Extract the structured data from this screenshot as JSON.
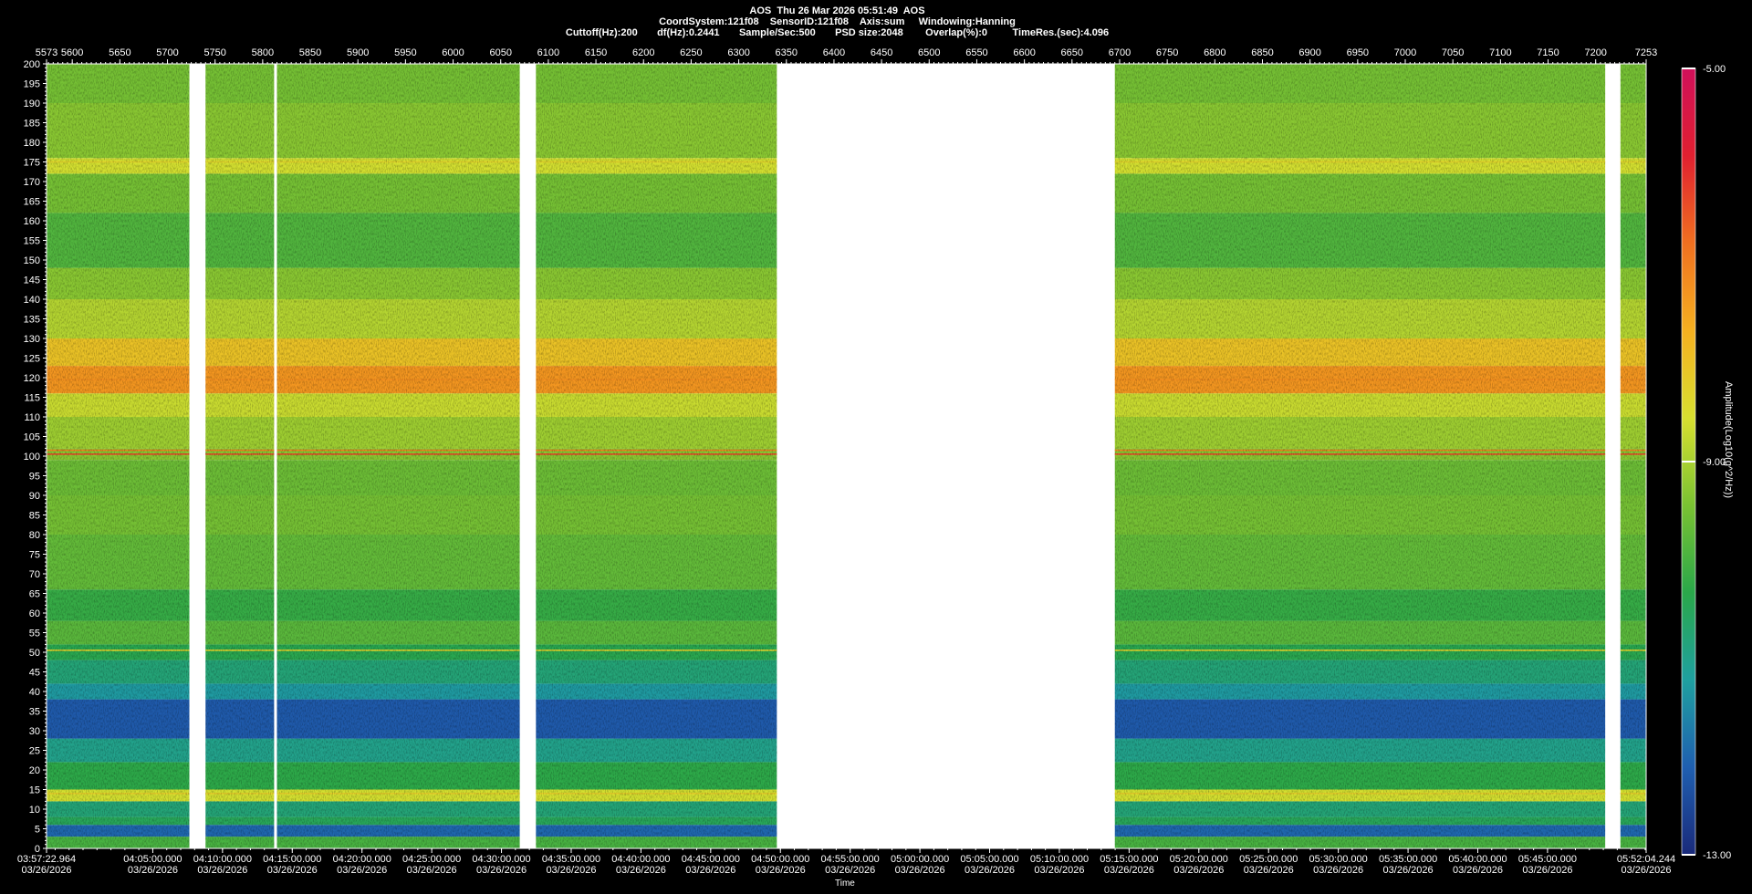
{
  "header": {
    "line1": "AOS  Thu 26 Mar 2026 05:51:49  AOS",
    "line2": "CoordSystem:121f08    SensorID:121f08    Axis:sum     Windowing:Hanning",
    "line3": "Cuttoff(Hz):200       df(Hz):0.2441       Sample/Sec:500       PSD size:2048        Overlap(%):0         TimeRes.(sec):4.096"
  },
  "chart_data": {
    "type": "heatmap",
    "title": "AOS  Thu 26 Mar 2026 05:51:49  AOS",
    "xlabel": "Time",
    "ylabel": "",
    "colorbar_label": "Amplitude(Log10(g^2/Hz))",
    "colorbar_ticks": [
      "-5.00",
      "-9.00",
      "-13.00"
    ],
    "colorbar_range": [
      -13.0,
      -5.0
    ],
    "colormap": [
      "#1a2a7a",
      "#1f5fb0",
      "#1fa0a0",
      "#2aa84a",
      "#7ac232",
      "#d8e030",
      "#f5b020",
      "#f07020",
      "#e02030",
      "#d0105a"
    ],
    "ylim": [
      0,
      200
    ],
    "y_ticks": [
      0,
      5,
      10,
      15,
      20,
      25,
      30,
      35,
      40,
      45,
      50,
      55,
      60,
      65,
      70,
      75,
      80,
      85,
      90,
      95,
      100,
      105,
      110,
      115,
      120,
      125,
      130,
      135,
      140,
      145,
      150,
      155,
      160,
      165,
      170,
      175,
      180,
      185,
      190,
      195,
      200
    ],
    "top_axis_ticks": [
      "5573",
      "5600",
      "5650",
      "5700",
      "5750",
      "5800",
      "5850",
      "5900",
      "5950",
      "6000",
      "6050",
      "6100",
      "6150",
      "6200",
      "6250",
      "6300",
      "6350",
      "6400",
      "6450",
      "6500",
      "6550",
      "6600",
      "6650",
      "6700",
      "6750",
      "6800",
      "6850",
      "6900",
      "6950",
      "7000",
      "7050",
      "7100",
      "7150",
      "7200",
      "7253"
    ],
    "top_axis_range": [
      5573,
      7253
    ],
    "bottom_axis_ticks": [
      {
        "time": "03:57:22.964",
        "date": "03/26/2026"
      },
      {
        "time": "04:05:00.000",
        "date": "03/26/2026"
      },
      {
        "time": "04:10:00.000",
        "date": "03/26/2026"
      },
      {
        "time": "04:15:00.000",
        "date": "03/26/2026"
      },
      {
        "time": "04:20:00.000",
        "date": "03/26/2026"
      },
      {
        "time": "04:25:00.000",
        "date": "03/26/2026"
      },
      {
        "time": "04:30:00.000",
        "date": "03/26/2026"
      },
      {
        "time": "04:35:00.000",
        "date": "03/26/2026"
      },
      {
        "time": "04:40:00.000",
        "date": "03/26/2026"
      },
      {
        "time": "04:45:00.000",
        "date": "03/26/2026"
      },
      {
        "time": "04:50:00.000",
        "date": "03/26/2026"
      },
      {
        "time": "04:55:00.000",
        "date": "03/26/2026"
      },
      {
        "time": "05:00:00.000",
        "date": "03/26/2026"
      },
      {
        "time": "05:05:00.000",
        "date": "03/26/2026"
      },
      {
        "time": "05:10:00.000",
        "date": "03/26/2026"
      },
      {
        "time": "05:15:00.000",
        "date": "03/26/2026"
      },
      {
        "time": "05:20:00.000",
        "date": "03/26/2026"
      },
      {
        "time": "05:25:00.000",
        "date": "03/26/2026"
      },
      {
        "time": "05:30:00.000",
        "date": "03/26/2026"
      },
      {
        "time": "05:35:00.000",
        "date": "03/26/2026"
      },
      {
        "time": "05:40:00.000",
        "date": "03/26/2026"
      },
      {
        "time": "05:45:00.000",
        "date": "03/26/2026"
      },
      {
        "time": "05:52:04.244",
        "date": "03/26/2026"
      }
    ],
    "data_segments": [
      {
        "start": 5573,
        "end": 5723
      },
      {
        "start": 5740,
        "end": 5812
      },
      {
        "start": 5815,
        "end": 6070
      },
      {
        "start": 6087,
        "end": 6340
      },
      {
        "start": 6695,
        "end": 7210
      },
      {
        "start": 7226,
        "end": 7253
      }
    ],
    "gaps_blank": [
      {
        "start": 6340,
        "end": 6695
      }
    ],
    "frequency_bands": [
      {
        "from": 0,
        "to": 3,
        "level": -10.0
      },
      {
        "from": 3,
        "to": 6,
        "level": -12.0
      },
      {
        "from": 6,
        "to": 8,
        "level": -10.5
      },
      {
        "from": 8,
        "to": 12,
        "level": -10.8
      },
      {
        "from": 12,
        "to": 15,
        "level": -8.6
      },
      {
        "from": 15,
        "to": 22,
        "level": -10.3
      },
      {
        "from": 22,
        "to": 28,
        "level": -11.0
      },
      {
        "from": 28,
        "to": 38,
        "level": -12.2
      },
      {
        "from": 38,
        "to": 42,
        "level": -11.3
      },
      {
        "from": 42,
        "to": 48,
        "level": -10.8
      },
      {
        "from": 48,
        "to": 52,
        "level": -10.4
      },
      {
        "from": 52,
        "to": 58,
        "level": -9.8
      },
      {
        "from": 58,
        "to": 66,
        "level": -10.2
      },
      {
        "from": 66,
        "to": 80,
        "level": -9.7
      },
      {
        "from": 80,
        "to": 90,
        "level": -9.5
      },
      {
        "from": 90,
        "to": 99,
        "level": -9.6
      },
      {
        "from": 99,
        "to": 102,
        "level": -9.3
      },
      {
        "from": 102,
        "to": 110,
        "level": -9.1
      },
      {
        "from": 110,
        "to": 116,
        "level": -8.7
      },
      {
        "from": 116,
        "to": 123,
        "level": -7.3
      },
      {
        "from": 123,
        "to": 130,
        "level": -8.0
      },
      {
        "from": 130,
        "to": 140,
        "level": -8.9
      },
      {
        "from": 140,
        "to": 148,
        "level": -9.3
      },
      {
        "from": 148,
        "to": 162,
        "level": -9.9
      },
      {
        "from": 162,
        "to": 172,
        "level": -9.5
      },
      {
        "from": 172,
        "to": 176,
        "level": -8.6
      },
      {
        "from": 176,
        "to": 190,
        "level": -9.3
      },
      {
        "from": 190,
        "to": 200,
        "level": -9.5
      }
    ],
    "tonal_lines": [
      {
        "freq": 100.5,
        "level": -6.3
      },
      {
        "freq": 101.5,
        "level": -7.0
      },
      {
        "freq": 50.5,
        "level": -8.3
      },
      {
        "freq": 119.5,
        "level": -7.2
      },
      {
        "freq": 175,
        "level": -8.3
      },
      {
        "freq": 14,
        "level": -8.2
      }
    ]
  }
}
